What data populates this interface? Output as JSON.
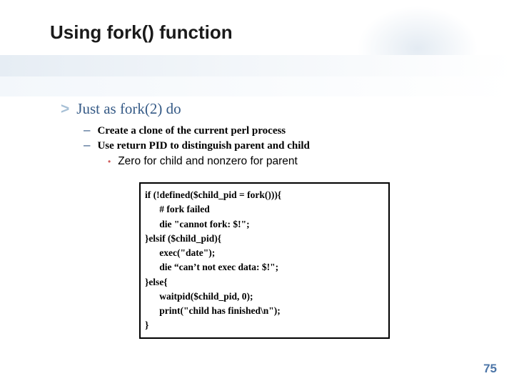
{
  "title": "Using fork() function",
  "bullets": {
    "lvl1_marker": ">",
    "lvl1": "Just as fork(2) do",
    "lvl2_marker": "–",
    "lvl2_a": "Create a clone of the current perl process",
    "lvl2_b": "Use return PID to distinguish parent and child",
    "lvl3_marker": "•",
    "lvl3": "Zero for child and nonzero for parent"
  },
  "code": "if (!defined($child_pid = fork())){\n      # fork failed\n      die \"cannot fork: $!\";\n}elsif ($child_pid){\n      exec(\"date\");\n      die “can’t not exec data: $!\";\n}else{\n      waitpid($child_pid, 0);\n      print(\"child has finished\\n\");\n}",
  "page_number": "75"
}
